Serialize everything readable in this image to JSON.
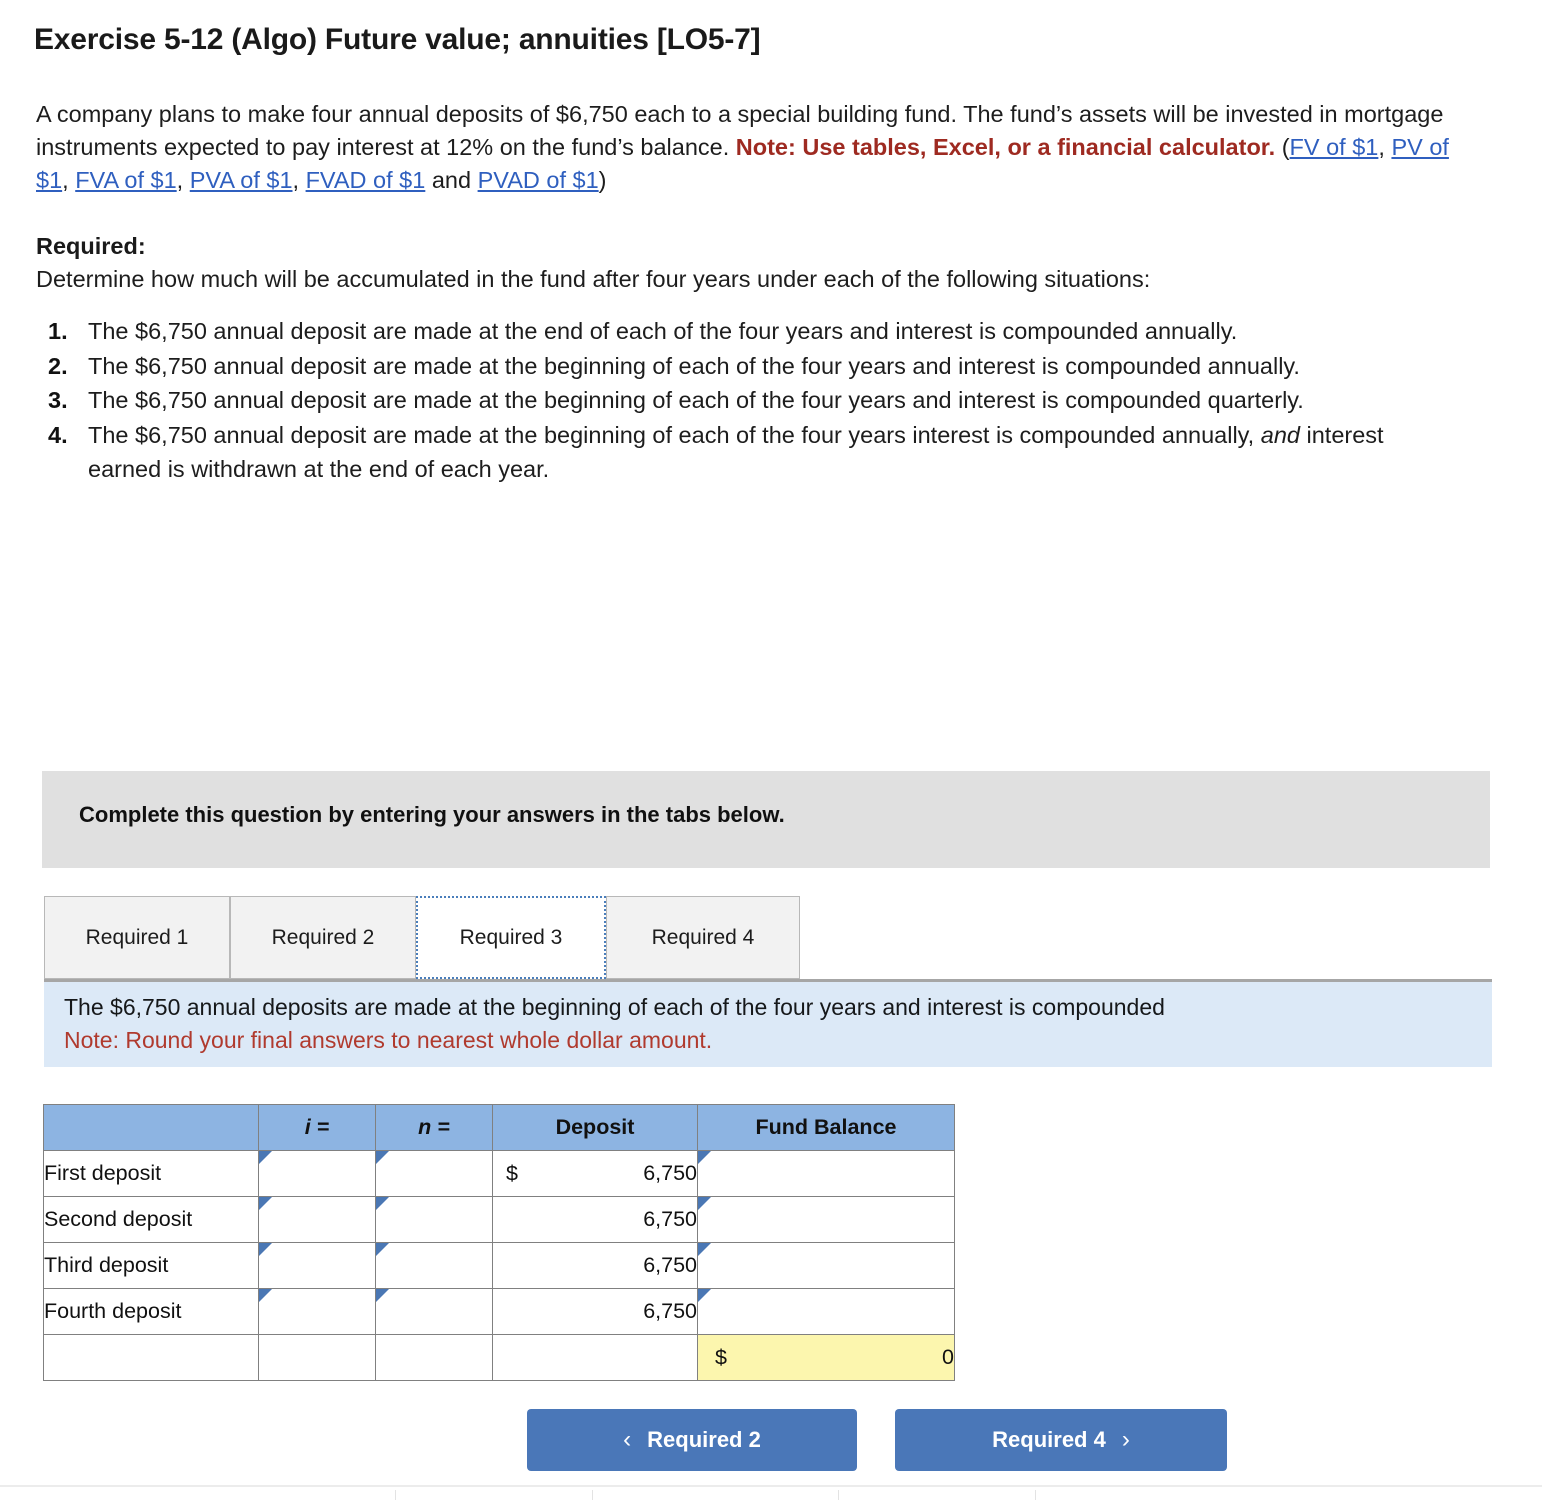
{
  "exercise": {
    "title": "Exercise 5-12 (Algo) Future value; annuities [LO5-7]",
    "problem_part1": "A company plans to make four annual deposits of $6,750 each to a special building fund. The fund’s assets will be invested in mortgage instruments expected to pay interest at 12% on the fund’s balance. ",
    "note_bold": "Note: Use tables, Excel, or a financial calculator.",
    "paren_open": " (",
    "paren_close": ")",
    "and_text": " and ",
    "comma": ", ",
    "links": [
      "FV of $1",
      "PV of $1",
      "FVA of $1",
      "PVA of $1",
      "FVAD of $1",
      "PVAD of $1"
    ],
    "required_label": "Required:",
    "required_text": "Determine how much will be accumulated in the fund after four years under each of the following situations:",
    "situations": [
      "The $6,750 annual deposit are made at the end of each of the four years and interest is compounded annually.",
      "The $6,750 annual deposit are made at the beginning of each of the four years and interest is compounded annually.",
      "The $6,750 annual deposit are made at the beginning of each of the four years and interest is compounded quarterly.",
      {
        "pre": "The $6,750 annual deposit are made at the beginning of each of the four years interest is compounded annually, ",
        "italic": "and",
        "post": " interest earned is withdrawn at the end of each year."
      }
    ]
  },
  "instruction_banner": {
    "text": "Complete this question by entering your answers in the tabs below."
  },
  "tabs": {
    "items": [
      {
        "label": "Required 1",
        "active": false
      },
      {
        "label": "Required 2",
        "active": false
      },
      {
        "label": "Required 3",
        "active": true
      },
      {
        "label": "Required 4",
        "active": false
      }
    ]
  },
  "tab_panel": {
    "description": "The $6,750 annual deposits are made at the beginning of each of the four years and interest is compounded",
    "note": "Note: Round your final answers to nearest whole dollar amount."
  },
  "answer_table": {
    "headers": [
      "",
      "i =",
      "n =",
      "Deposit",
      "Fund Balance"
    ],
    "rows": [
      {
        "label": "First deposit",
        "i": "",
        "n": "",
        "dollar": "$",
        "deposit": "6,750",
        "fund": ""
      },
      {
        "label": "Second deposit",
        "i": "",
        "n": "",
        "dollar": "",
        "deposit": "6,750",
        "fund": ""
      },
      {
        "label": "Third deposit",
        "i": "",
        "n": "",
        "dollar": "",
        "deposit": "6,750",
        "fund": ""
      },
      {
        "label": "Fourth deposit",
        "i": "",
        "n": "",
        "dollar": "",
        "deposit": "6,750",
        "fund": ""
      }
    ],
    "total": {
      "dollar": "$",
      "value": "0"
    }
  },
  "navigation": {
    "prev_label": "Required 2",
    "next_label": "Required 4",
    "prev_chevron": "‹",
    "next_chevron": "›"
  },
  "colors": {
    "header_blue": "#8db4e2",
    "input_border_blue": "#4a77b4",
    "total_yellow": "#fcf6ae",
    "banner_gray": "#e0e0e0",
    "banner_blue": "#dce9f7",
    "button_blue": "#4a77b8",
    "note_red": "#9e2a21",
    "link_blue": "#2f5fbf"
  }
}
